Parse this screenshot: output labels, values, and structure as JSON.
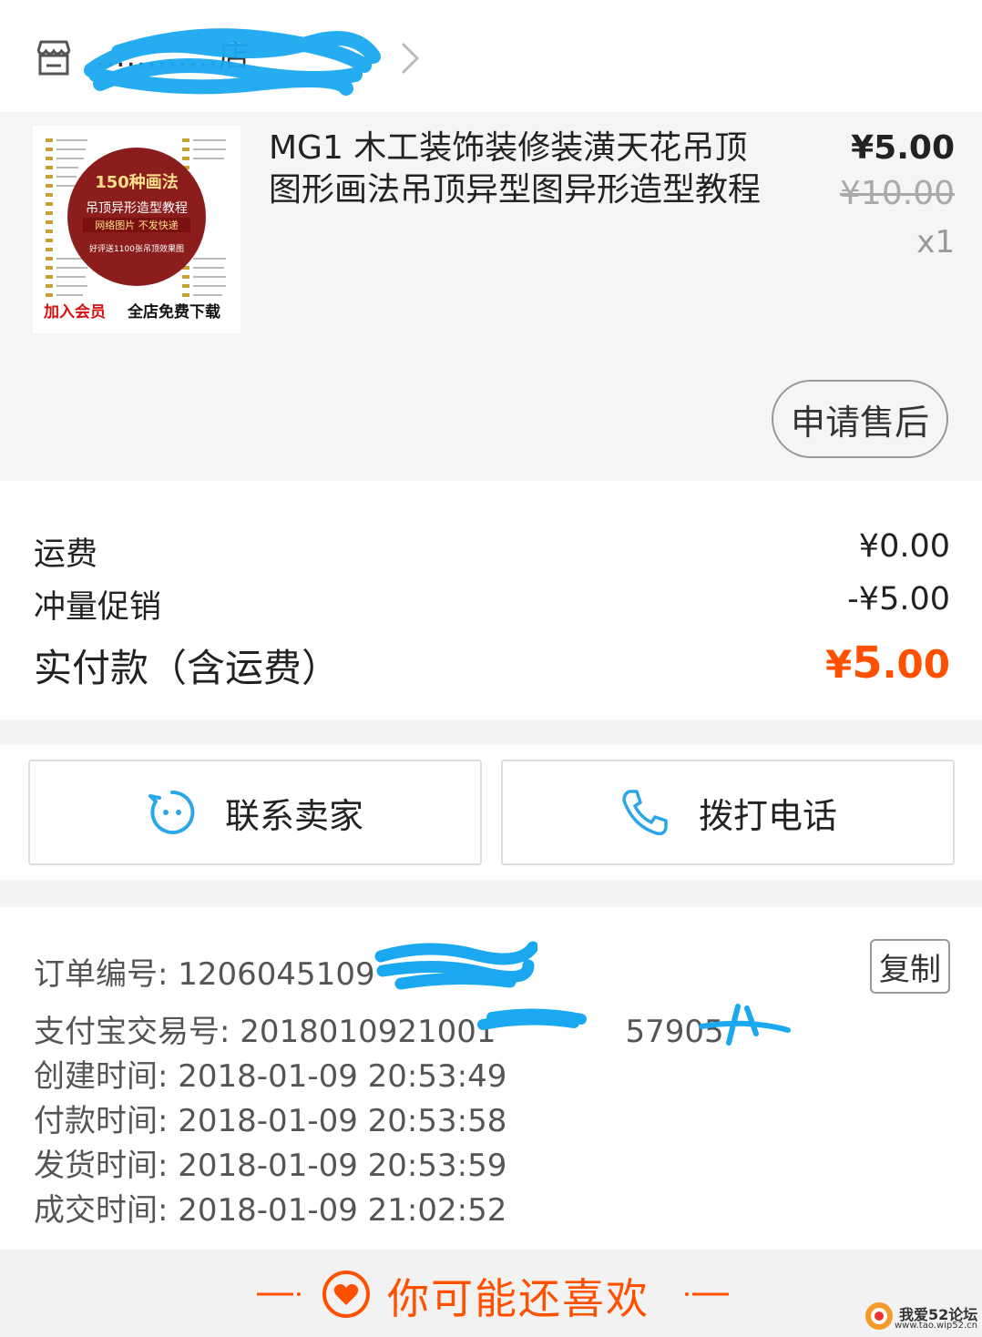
{
  "store": {
    "name": "…………店",
    "icon": "store-icon"
  },
  "product": {
    "title": "MG1  木工装饰装修装潢天花吊顶图形画法吊顶异型图异形造型教程",
    "price_now": "¥5.00",
    "price_original": "¥10.00",
    "quantity": "x1",
    "thumb": {
      "badge": "150种画法",
      "line1": "吊顶异形造型教程",
      "line2": "网络图片 不发快递",
      "line3": "好评送1100张吊顶效果图",
      "footer_left": "加入会员",
      "footer_right": "全店免费下载"
    },
    "aftersale_label": "申请售后"
  },
  "fees": {
    "shipping_label": "运费",
    "shipping_value": "¥0.00",
    "promo_label": "冲量促销",
    "promo_value": "-¥5.00",
    "paid_label": "实付款（含运费）",
    "paid_currency": "¥",
    "paid_int": "5",
    "paid_dec": ".00"
  },
  "actions": {
    "contact_label": "联系卖家",
    "call_label": "拨打电话"
  },
  "order": {
    "order_no_label": "订单编号: ",
    "order_no": "1206045109",
    "alipay_label": "支付宝交易号: ",
    "alipay_no": "2018010921001",
    "alipay_no_tail": "57905",
    "created": "创建时间: 2018-01-09 20:53:49",
    "paid": "付款时间: 2018-01-09 20:53:58",
    "shipped": "发货时间: 2018-01-09 20:53:59",
    "done": "成交时间: 2018-01-09 21:02:52",
    "copy_label": "复制"
  },
  "recommend": {
    "label": "你可能还喜欢"
  },
  "watermark": {
    "text": "我爱52论坛",
    "url": "www.tao.wip52.cn"
  },
  "colors": {
    "accent": "#ff5000",
    "blue_icon": "#2aa7e8",
    "scribble": "#1aa8f0"
  }
}
